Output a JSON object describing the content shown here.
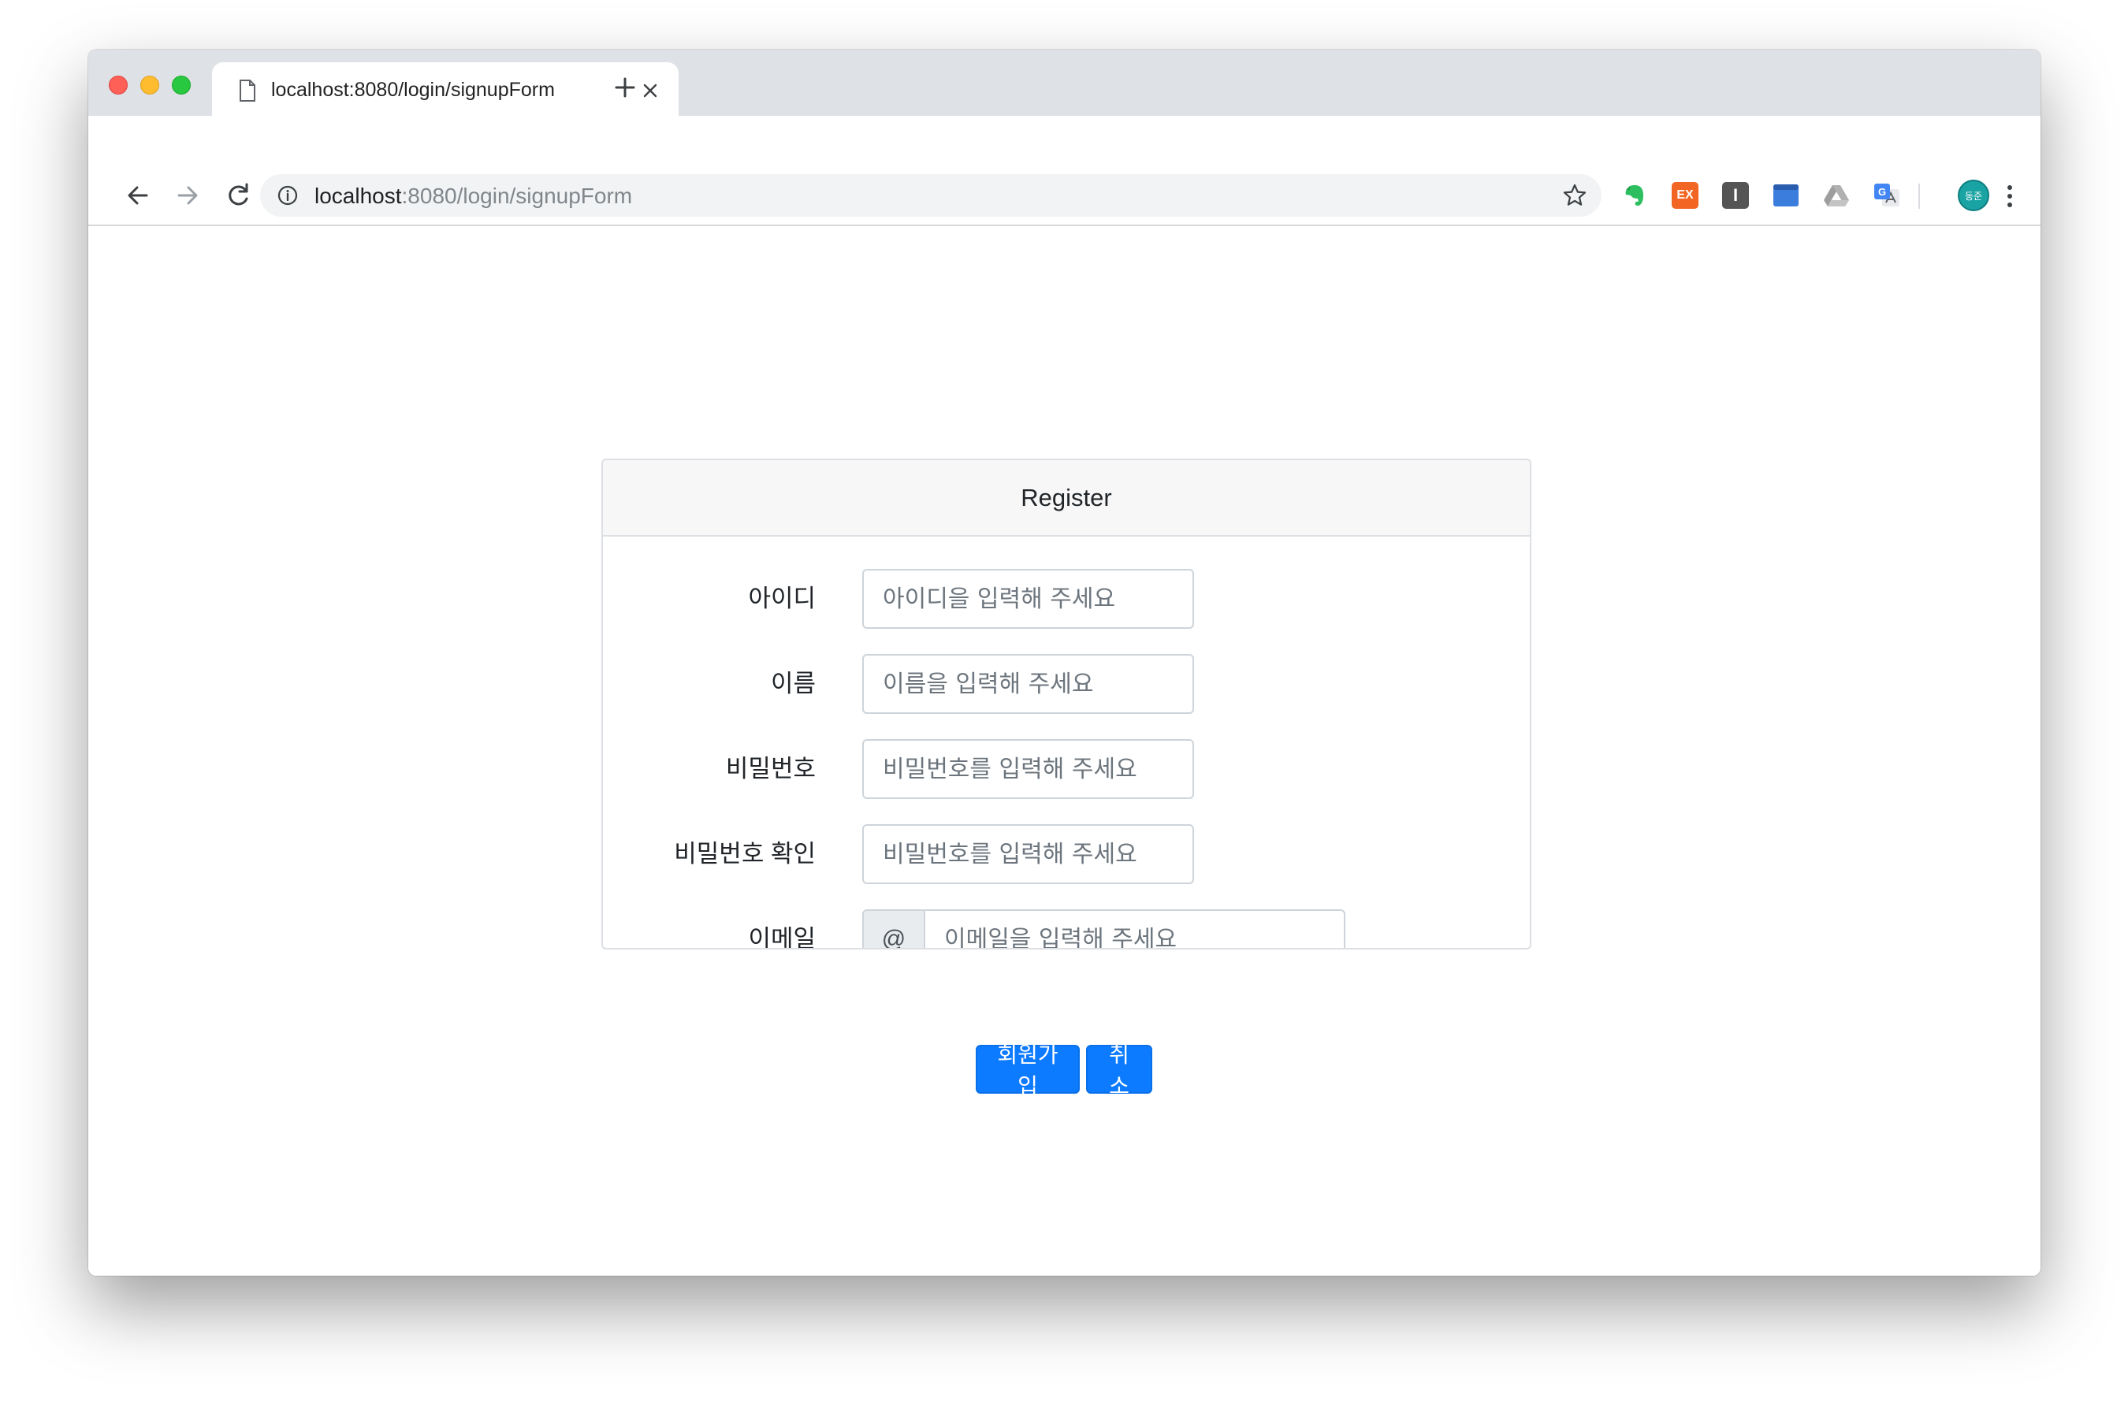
{
  "browser": {
    "tab_title": "localhost:8080/login/signupForm",
    "url_host": "localhost",
    "url_path": ":8080/login/signupForm",
    "extensions": [
      {
        "name": "evernote",
        "color": "#2dbe60"
      },
      {
        "name": "ex",
        "label": "EX",
        "color": "#f26522"
      },
      {
        "name": "instapaper",
        "label": "I",
        "color": "#555555"
      },
      {
        "name": "window",
        "color": "#3b7ddd"
      },
      {
        "name": "drive",
        "color": "#9e9e9e"
      },
      {
        "name": "translate",
        "color": "#4285f4"
      }
    ],
    "avatar_label": "동준"
  },
  "form": {
    "title": "Register",
    "fields": [
      {
        "label": "아이디",
        "placeholder": "아이디을 입력해 주세요"
      },
      {
        "label": "이름",
        "placeholder": "이름을 입력해 주세요"
      },
      {
        "label": "비밀번호",
        "placeholder": "비밀번호를 입력해 주세요"
      },
      {
        "label": "비밀번호 확인",
        "placeholder": "비밀번호를 입력해 주세요"
      },
      {
        "label": "이메일",
        "prepend": "@",
        "placeholder": "이메일을 입력해 주세요"
      }
    ],
    "submit_label": "회원가입",
    "cancel_label": "취소"
  }
}
